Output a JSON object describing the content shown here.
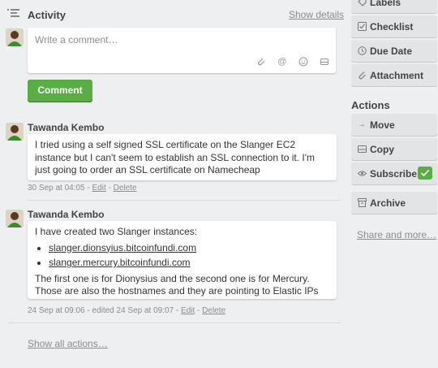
{
  "activity": {
    "title": "Activity",
    "show_details": "Show details",
    "comment_placeholder": "Write a comment…",
    "comment_button": "Comment",
    "show_all": "Show all actions…"
  },
  "entries": [
    {
      "author": "Tawanda Kembo",
      "text": "I tried using a self signed SSL certificate on the Slanger EC2 instance but I can't seem to establish an SSL connection to it. I'm just going to order an SSL certificate on Namecheap",
      "date": "30 Sep at 04:05",
      "edit": "Edit",
      "delete": "Delete",
      "sep1": " - ",
      "sep2": " - "
    },
    {
      "author": "Tawanda Kembo",
      "intro": "I have created two Slanger instances:",
      "links": [
        "slanger.dionsyius.bitcoinfundi.com",
        "slanger.mercury.bitcoinfundi.com"
      ],
      "outro": "The first one is for Dionysius and the second one is for Mercury. Those are also the hostnames and they are pointing to Elastic IPs",
      "date": "24 Sep at 09:06 - edited 24 Sep at 09:07",
      "edit": "Edit",
      "delete": "Delete",
      "sep1": " - ",
      "sep2": " - "
    }
  ],
  "sidebar": {
    "labels": "Labels",
    "checklist": "Checklist",
    "due_date": "Due Date",
    "attachment": "Attachment",
    "actions_title": "Actions",
    "move": "Move",
    "copy": "Copy",
    "subscribe": "Subscribe",
    "archive": "Archive",
    "share_more": "Share and more…"
  },
  "colors": {
    "accent_green": "#5aac44",
    "background": "#edeff0"
  }
}
